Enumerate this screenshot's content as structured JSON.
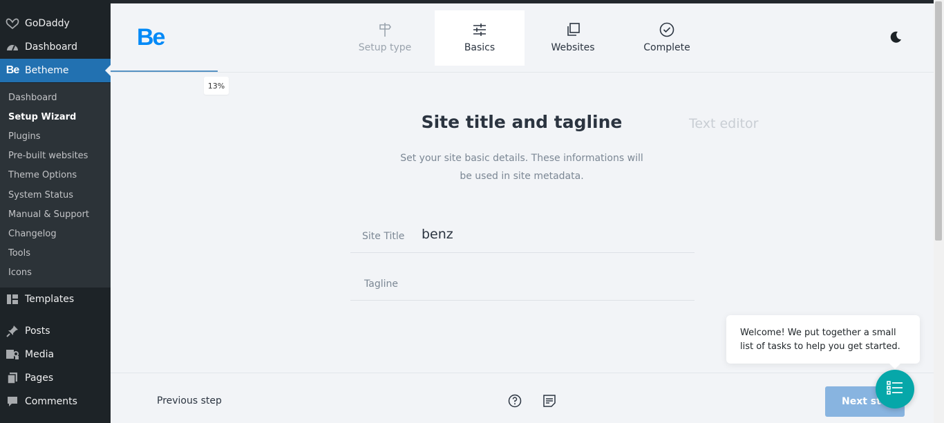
{
  "sidebar": {
    "items": [
      {
        "label": "GoDaddy",
        "icon": "godaddy-icon"
      },
      {
        "label": "Dashboard",
        "icon": "dashboard-icon"
      },
      {
        "label": "Betheme",
        "icon": "betheme-icon"
      },
      {
        "label": "Templates",
        "icon": "templates-icon"
      },
      {
        "label": "Posts",
        "icon": "pin-icon"
      },
      {
        "label": "Media",
        "icon": "media-icon"
      },
      {
        "label": "Pages",
        "icon": "pages-icon"
      },
      {
        "label": "Comments",
        "icon": "comments-icon"
      }
    ],
    "submenu": [
      "Dashboard",
      "Setup Wizard",
      "Plugins",
      "Pre-built websites",
      "Theme Options",
      "System Status",
      "Manual & Support",
      "Changelog",
      "Tools",
      "Icons"
    ],
    "current_submenu": "Setup Wizard"
  },
  "header": {
    "logo": "Be",
    "steps": [
      {
        "label": "Setup type",
        "icon": "signpost-icon",
        "state": "done"
      },
      {
        "label": "Basics",
        "icon": "sliders-icon",
        "state": "active"
      },
      {
        "label": "Websites",
        "icon": "copy-icon",
        "state": "upcoming"
      },
      {
        "label": "Complete",
        "icon": "check-circle-icon",
        "state": "upcoming"
      }
    ],
    "progress_label": "13%",
    "progress_percent": 13
  },
  "main": {
    "title": "Site title and tagline",
    "text_editor": "Text editor",
    "description_line1": "Set your site basic details. These informations will",
    "description_line2": "be used in site metadata.",
    "fields": [
      {
        "label": "Site Title",
        "value": "benz"
      },
      {
        "label": "Tagline",
        "value": ""
      }
    ]
  },
  "footer": {
    "prev_label": "Previous step",
    "next_label": "Next step"
  },
  "tooltip": {
    "text": "Welcome! We put together a small list of tasks to help you get started."
  },
  "colors": {
    "accent": "#2271b1",
    "brand": "#0089f7",
    "fab": "#06a7a9",
    "sidebar_bg": "#1d2327"
  }
}
